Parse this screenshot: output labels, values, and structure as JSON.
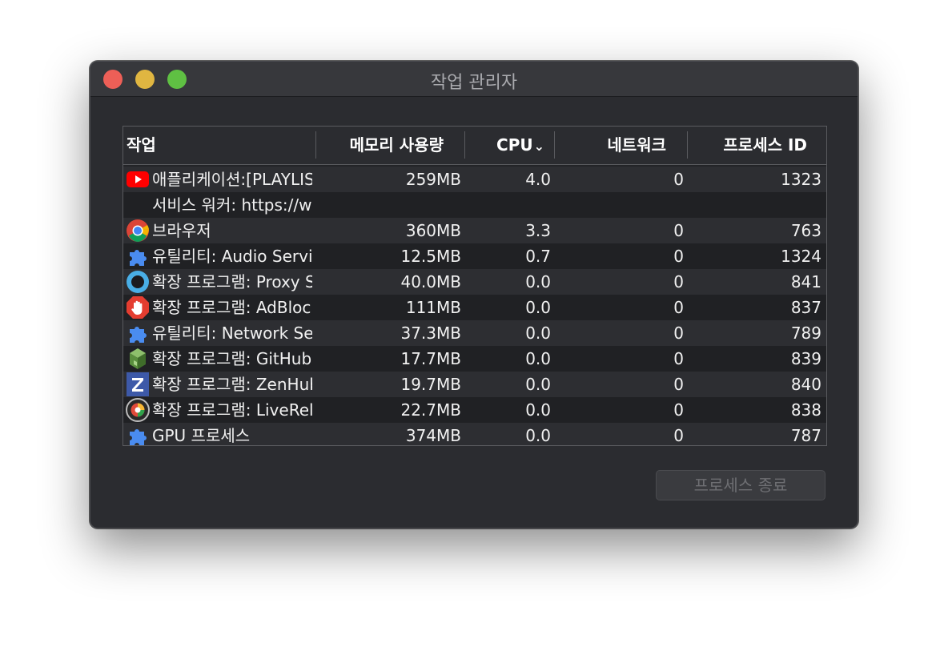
{
  "window": {
    "title": "작업 관리자"
  },
  "table": {
    "headers": {
      "task": "작업",
      "memory": "메모리 사용량",
      "cpu": "CPU",
      "network": "네트워크",
      "pid": "프로세스 ID"
    },
    "rows": [
      {
        "icon": "youtube-icon",
        "task": "애플리케이션:[PLAYLIST",
        "memory": "259MB",
        "cpu": "4.0",
        "network": "0",
        "pid": "1323"
      },
      {
        "icon": "",
        "task": "서비스 워커: https://www",
        "memory": "",
        "cpu": "",
        "network": "",
        "pid": ""
      },
      {
        "icon": "chrome-icon",
        "task": "브라우저",
        "memory": "360MB",
        "cpu": "3.3",
        "network": "0",
        "pid": "763"
      },
      {
        "icon": "puzzle-icon",
        "task": "유틸리티: Audio Service",
        "memory": "12.5MB",
        "cpu": "0.7",
        "network": "0",
        "pid": "1324"
      },
      {
        "icon": "proxy-icon",
        "task": "확장 프로그램: Proxy SwitchyOmega",
        "memory": "40.0MB",
        "cpu": "0.0",
        "network": "0",
        "pid": "841"
      },
      {
        "icon": "adblock-icon",
        "task": "확장 프로그램: AdBlock",
        "memory": "111MB",
        "cpu": "0.0",
        "network": "0",
        "pid": "837"
      },
      {
        "icon": "puzzle-icon",
        "task": "유틸리티: Network Service",
        "memory": "37.3MB",
        "cpu": "0.0",
        "network": "0",
        "pid": "789"
      },
      {
        "icon": "github-cube-icon",
        "task": "확장 프로그램: GitHub",
        "memory": "17.7MB",
        "cpu": "0.0",
        "network": "0",
        "pid": "839"
      },
      {
        "icon": "zenhub-icon",
        "task": "확장 프로그램: ZenHub",
        "memory": "19.7MB",
        "cpu": "0.0",
        "network": "0",
        "pid": "840"
      },
      {
        "icon": "livereload-icon",
        "task": "확장 프로그램: LiveReload",
        "memory": "22.7MB",
        "cpu": "0.0",
        "network": "0",
        "pid": "838"
      },
      {
        "icon": "puzzle-icon",
        "task": "GPU 프로세스",
        "memory": "374MB",
        "cpu": "0.0",
        "network": "0",
        "pid": "787"
      }
    ]
  },
  "buttons": {
    "end_process": "프로세스 종료"
  },
  "colors": {
    "window_bg": "#2b2c30",
    "close": "#ed5f57",
    "minimize": "#e0b641",
    "maximize": "#5fc043",
    "puzzle": "#4a8cf0"
  }
}
